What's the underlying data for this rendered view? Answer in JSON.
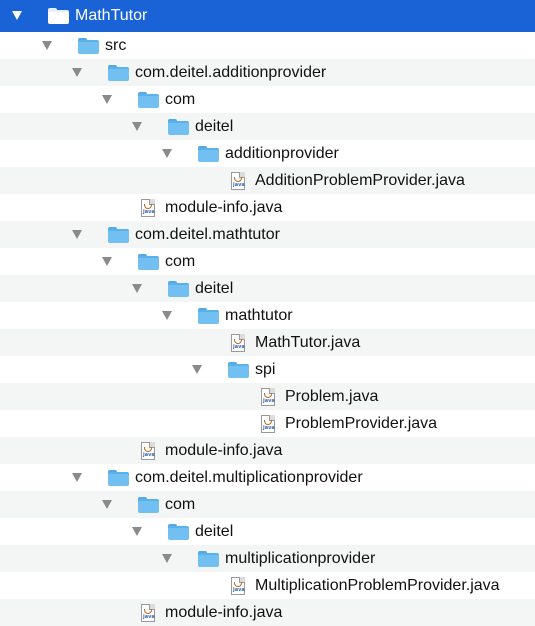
{
  "tree": {
    "items": [
      {
        "label": "MathTutor",
        "type": "folder",
        "depth": 0,
        "expanded": true,
        "selected": true
      },
      {
        "label": "src",
        "type": "folder",
        "depth": 1,
        "expanded": true
      },
      {
        "label": "com.deitel.additionprovider",
        "type": "folder",
        "depth": 2,
        "expanded": true
      },
      {
        "label": "com",
        "type": "folder",
        "depth": 3,
        "expanded": true
      },
      {
        "label": "deitel",
        "type": "folder",
        "depth": 4,
        "expanded": true
      },
      {
        "label": "additionprovider",
        "type": "folder",
        "depth": 5,
        "expanded": true
      },
      {
        "label": "AdditionProblemProvider.java",
        "type": "java-file",
        "depth": 6
      },
      {
        "label": "module-info.java",
        "type": "java-file",
        "depth": 3
      },
      {
        "label": "com.deitel.mathtutor",
        "type": "folder",
        "depth": 2,
        "expanded": true
      },
      {
        "label": "com",
        "type": "folder",
        "depth": 3,
        "expanded": true
      },
      {
        "label": "deitel",
        "type": "folder",
        "depth": 4,
        "expanded": true
      },
      {
        "label": "mathtutor",
        "type": "folder",
        "depth": 5,
        "expanded": true
      },
      {
        "label": "MathTutor.java",
        "type": "java-file",
        "depth": 6
      },
      {
        "label": "spi",
        "type": "folder",
        "depth": 6,
        "expanded": true
      },
      {
        "label": "Problem.java",
        "type": "java-file",
        "depth": 7
      },
      {
        "label": "ProblemProvider.java",
        "type": "java-file",
        "depth": 7
      },
      {
        "label": "module-info.java",
        "type": "java-file",
        "depth": 3
      },
      {
        "label": "com.deitel.multiplicationprovider",
        "type": "folder",
        "depth": 2,
        "expanded": true
      },
      {
        "label": "com",
        "type": "folder",
        "depth": 3,
        "expanded": true
      },
      {
        "label": "deitel",
        "type": "folder",
        "depth": 4,
        "expanded": true
      },
      {
        "label": "multiplicationprovider",
        "type": "folder",
        "depth": 5,
        "expanded": true
      },
      {
        "label": "MultiplicationProblemProvider.java",
        "type": "java-file",
        "depth": 6
      },
      {
        "label": "module-info.java",
        "type": "java-file",
        "depth": 3
      }
    ],
    "colors": {
      "selection": "#1a63d6",
      "stripe": "#f4f5f5",
      "folder": "#72c0f2",
      "disclosure": "#8a8a8a"
    }
  }
}
